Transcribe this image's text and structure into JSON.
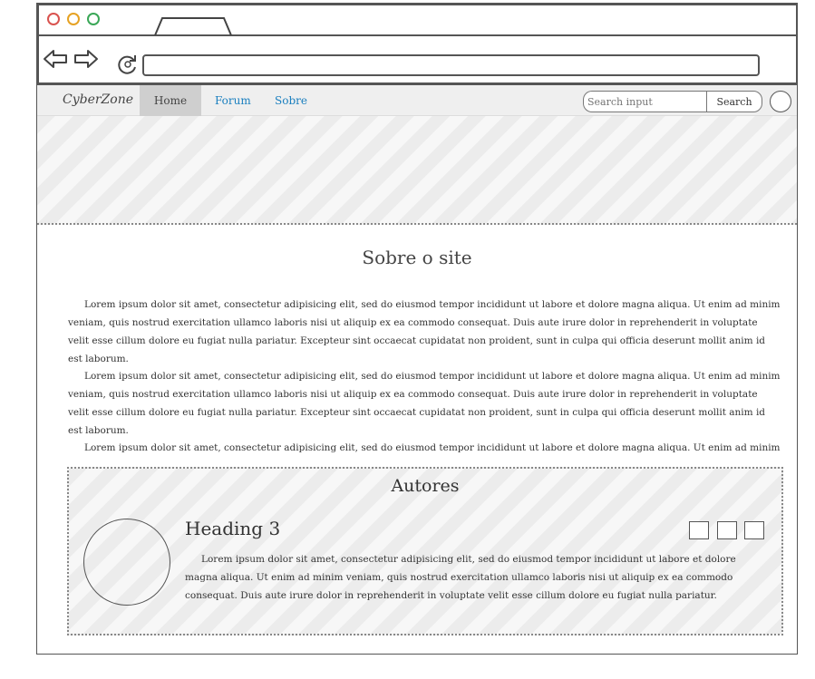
{
  "browser": {
    "controls": [
      "close-dot",
      "minimize-dot",
      "maximize-dot"
    ]
  },
  "navbar": {
    "brand": "CyberZone",
    "items": [
      {
        "label": "Home",
        "active": true
      },
      {
        "label": "Forum",
        "active": false
      },
      {
        "label": "Sobre",
        "active": false
      }
    ],
    "search": {
      "placeholder": "Search input",
      "button_label": "Search"
    }
  },
  "main": {
    "title": "Sobre o site",
    "paragraphs": [
      "Lorem ipsum dolor sit amet, consectetur adipisicing elit, sed do eiusmod tempor incididunt ut labore et dolore magna aliqua. Ut enim ad minim veniam, quis nostrud exercitation ullamco laboris nisi ut aliquip ex ea commodo consequat. Duis aute irure dolor in reprehenderit in voluptate velit esse cillum dolore eu fugiat nulla pariatur. Excepteur sint occaecat cupidatat non proident, sunt in culpa qui officia deserunt mollit anim id est laborum.",
      "Lorem ipsum dolor sit amet, consectetur adipisicing elit, sed do eiusmod tempor incididunt ut labore et dolore magna aliqua. Ut enim ad minim veniam, quis nostrud exercitation ullamco laboris nisi ut aliquip ex ea commodo consequat. Duis aute irure dolor in reprehenderit in voluptate velit esse cillum dolore eu fugiat nulla pariatur. Excepteur sint occaecat cupidatat non proident, sunt in culpa qui officia deserunt mollit anim id est laborum.",
      "Lorem ipsum dolor sit amet, consectetur adipisicing elit, sed do eiusmod tempor incididunt ut labore et dolore magna aliqua. Ut enim ad minim veniam,"
    ]
  },
  "authors": {
    "title": "Autores",
    "heading": "Heading 3",
    "text": "Lorem ipsum dolor sit amet, consectetur adipisicing elit, sed do eiusmod tempor incididunt ut labore et dolore magna aliqua. Ut enim ad minim veniam, quis nostrud exercitation ullamco laboris nisi ut aliquip ex ea commodo consequat. Duis aute irure dolor in reprehenderit in voluptate velit esse cillum dolore eu fugiat nulla pariatur. Excepteur sint occaecat cupidatat"
  },
  "colors": {
    "link": "#1a7fbf",
    "dot_red": "#d9534f",
    "dot_yellow": "#e6a223",
    "dot_green": "#3aa757"
  }
}
